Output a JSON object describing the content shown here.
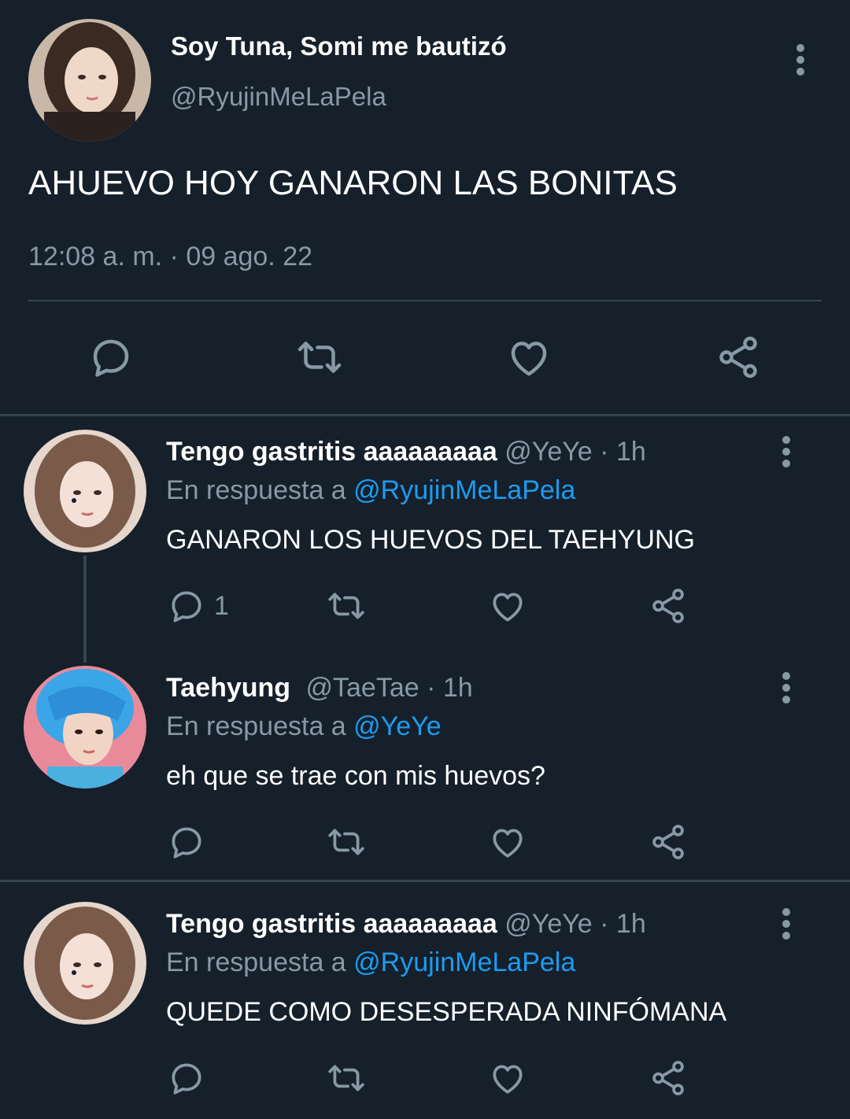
{
  "main_tweet": {
    "display_name": "Soy Tuna, Somi me bautizó",
    "handle": "@RyujinMeLaPela",
    "text": "AHUEVO HOY GANARON LAS BONITAS",
    "timestamp": "12:08 a. m. · 09 ago. 22",
    "actions": [
      "reply-icon",
      "retweet-icon",
      "like-icon",
      "share-icon"
    ]
  },
  "replies": [
    {
      "display_name": "Tengo gastritis aaaaaaaaa",
      "handle_time": "@YeYe · 1h",
      "reply_prefix": "En respuesta a",
      "reply_to": "@RyujinMeLaPela",
      "text": "GANARON LOS HUEVOS DEL TAEHYUNG",
      "reply_count": "1"
    },
    {
      "display_name": "Taehyung",
      "handle_time": "@TaeTae · 1h",
      "reply_prefix": "En respuesta a",
      "reply_to": "@YeYe",
      "text": "eh que se trae con mis huevos?"
    },
    {
      "display_name": "Tengo gastritis aaaaaaaaa",
      "handle_time": "@YeYe · 1h",
      "reply_prefix": "En respuesta a",
      "reply_to": "@RyujinMeLaPela",
      "text": "QUEDE COMO DESESPERADA NINFÓMANA"
    }
  ],
  "colors": {
    "background": "#15202b",
    "secondary_text": "#8899a6",
    "mention": "#1d9bf0",
    "divider": "#38444d"
  }
}
